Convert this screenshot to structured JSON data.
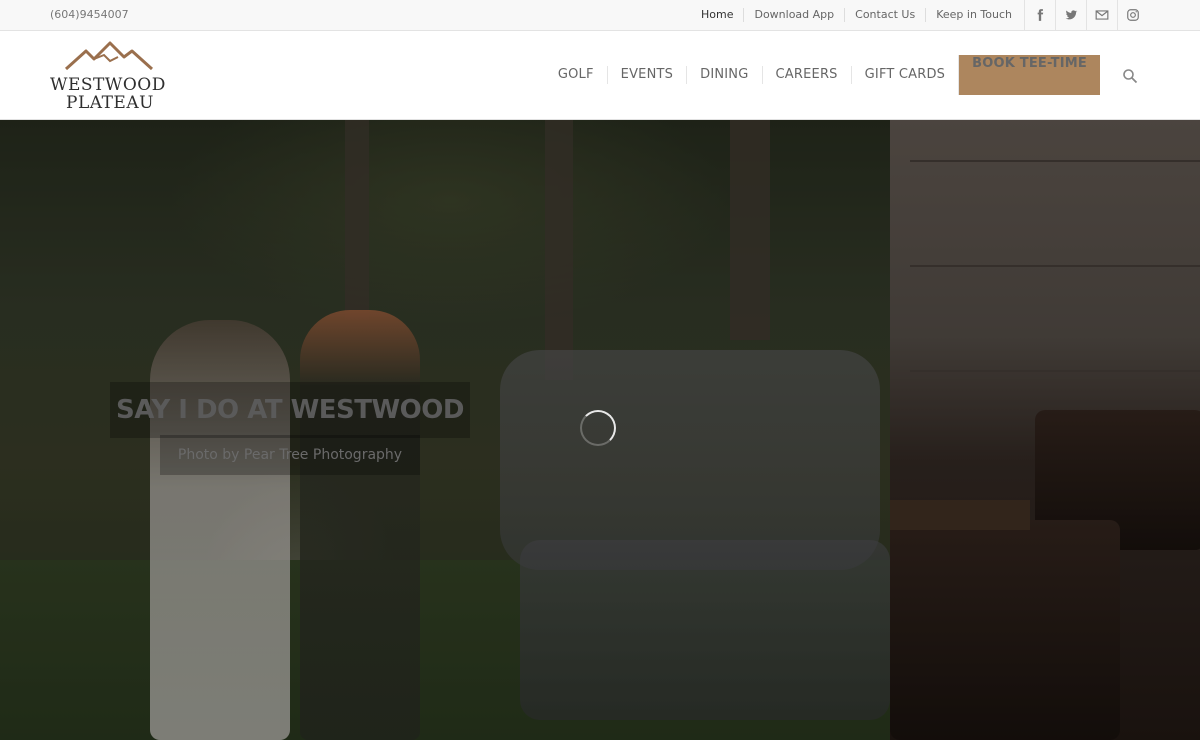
{
  "topbar": {
    "phone": "(604)9454007",
    "links": [
      "Home",
      "Download App",
      "Contact Us",
      "Keep in Touch"
    ],
    "social_icons": [
      "facebook-icon",
      "twitter-icon",
      "mail-icon",
      "instagram-icon"
    ]
  },
  "header": {
    "logo_line1": "WESTWOOD",
    "logo_line2": "PLATEAU",
    "nav": [
      "GOLF",
      "EVENTS",
      "DINING",
      "CAREERS",
      "GIFT CARDS"
    ],
    "cta": "BOOK TEE-TIME",
    "cta_color": "#ad865e"
  },
  "hero": {
    "title": "SAY I DO AT WESTWOOD",
    "subtitle": "Photo by Pear Tree Photography"
  }
}
